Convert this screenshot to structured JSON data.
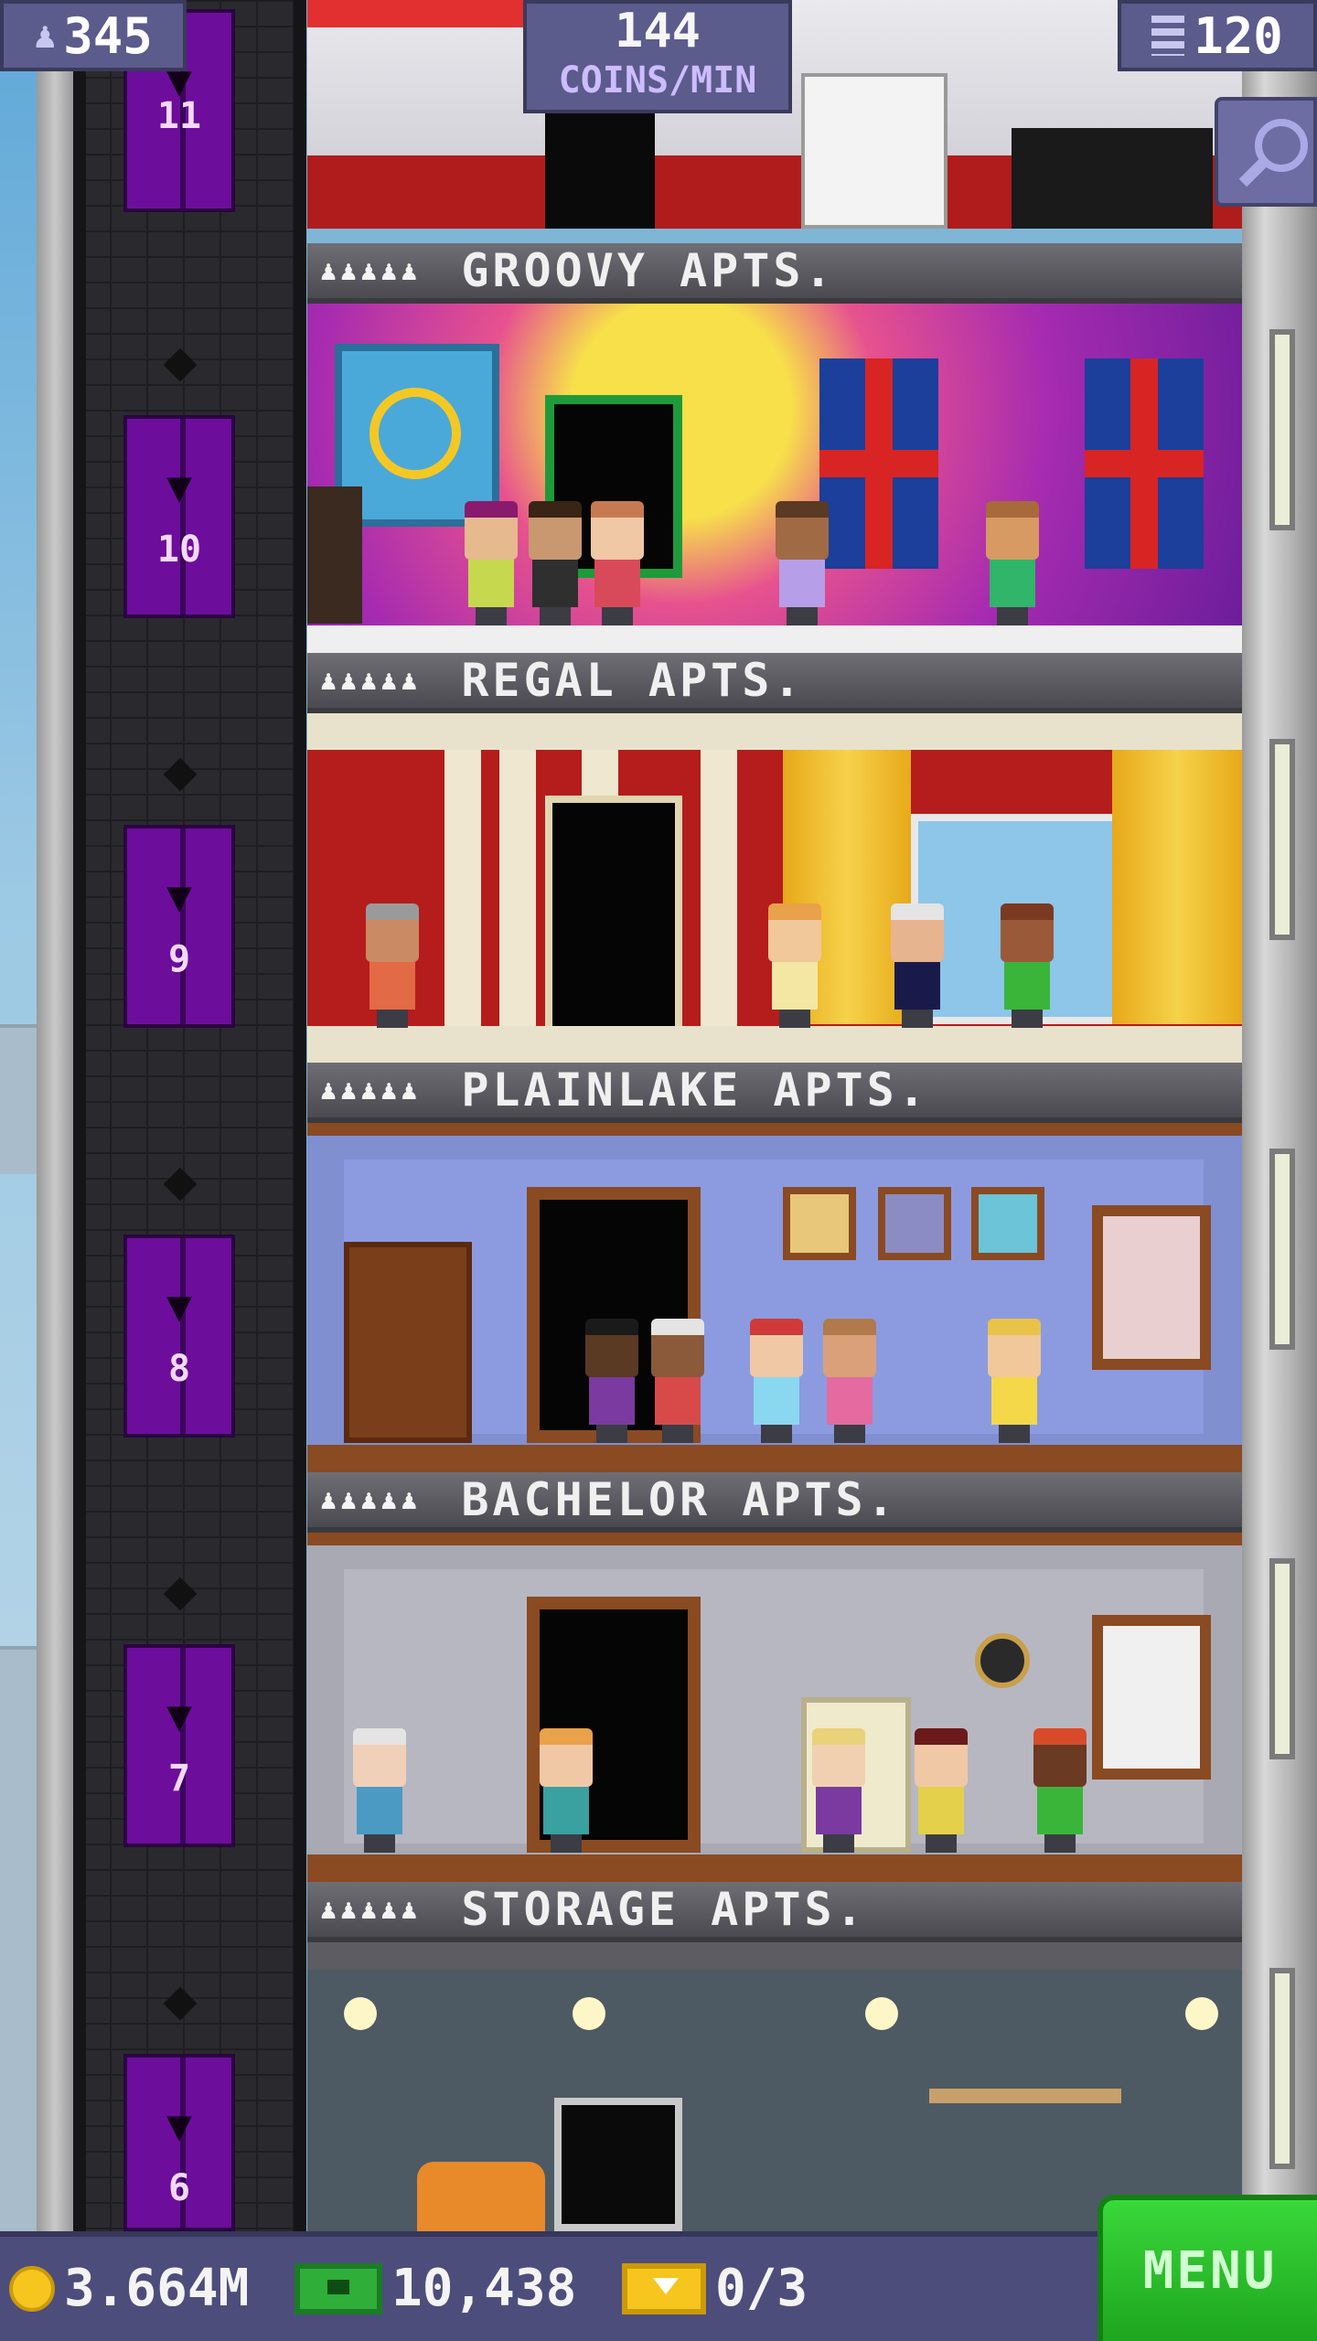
{
  "hud": {
    "population": "345",
    "coins_per_min_value": "144",
    "coins_per_min_label": "COINS/MIN",
    "floors": "120"
  },
  "floors": [
    {
      "number": "11",
      "name": "",
      "stars": "",
      "theme": "lobby-top"
    },
    {
      "number": "10",
      "name": "GROOVY APTS.",
      "stars": "♟♟♟♟♟"
    },
    {
      "number": "9",
      "name": "REGAL APTS.",
      "stars": "♟♟♟♟♟"
    },
    {
      "number": "8",
      "name": "PLAINLAKE APTS.",
      "stars": "♟♟♟♟♟"
    },
    {
      "number": "7",
      "name": "BACHELOR APTS.",
      "stars": "♟♟♟♟♟"
    },
    {
      "number": "6",
      "name": "STORAGE APTS.",
      "stars": "♟♟♟♟♟"
    }
  ],
  "bottom_bar": {
    "coins": "3.664M",
    "bux": "10,438",
    "tickets": "0/3"
  },
  "menu_label": "MENU",
  "colors": {
    "hud_bg": "#5b5b8c",
    "elevator": "#6c0d9c",
    "menu_green": "#2fc42f"
  }
}
